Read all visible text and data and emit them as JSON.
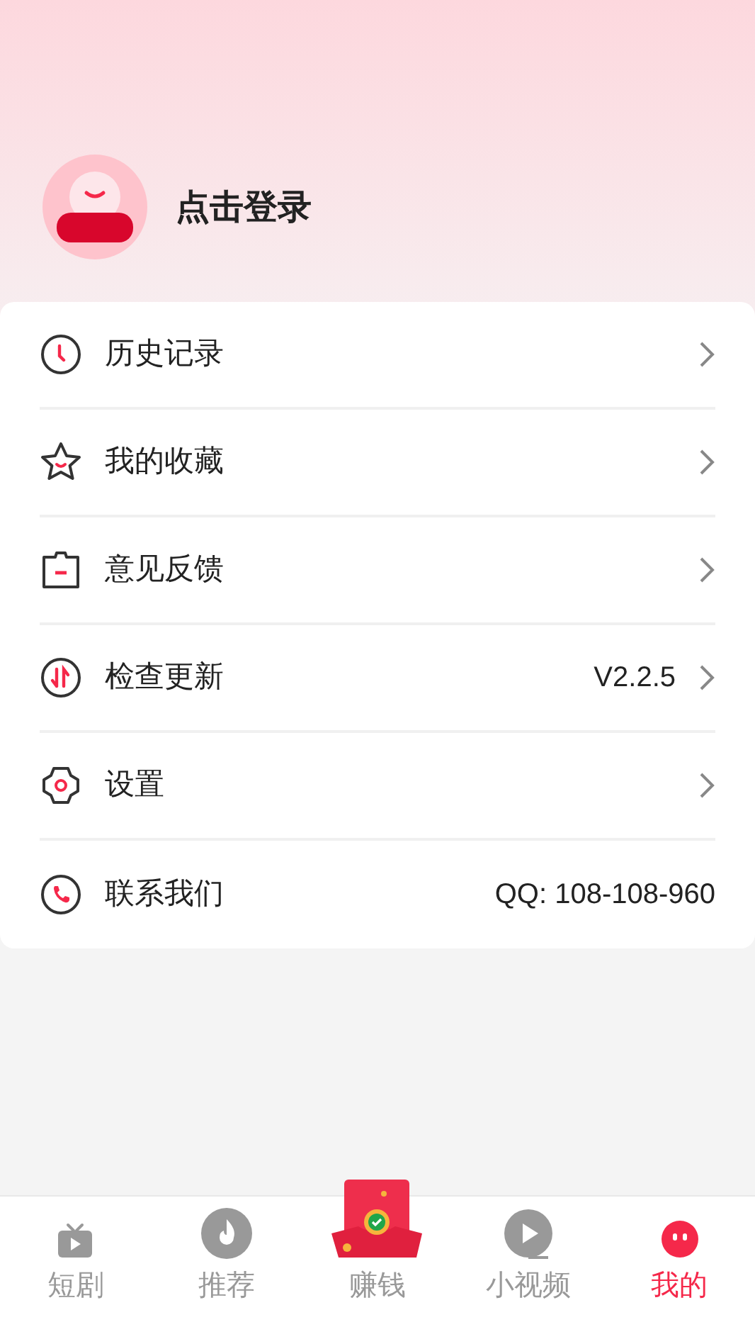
{
  "profile": {
    "login_label": "点击登录"
  },
  "menu": [
    {
      "label": "历史记录",
      "kind": "link"
    },
    {
      "label": "我的收藏",
      "kind": "link"
    },
    {
      "label": "意见反馈",
      "kind": "link"
    },
    {
      "label": "检查更新",
      "kind": "link",
      "value": "V2.2.5"
    },
    {
      "label": "设置",
      "kind": "link"
    },
    {
      "label": "联系我们",
      "kind": "info",
      "value": "QQ: 108-108-960"
    }
  ],
  "tab_bar": [
    {
      "label": "短剧",
      "selected": false
    },
    {
      "label": "推荐",
      "selected": false
    },
    {
      "label": "赚钱",
      "selected": false
    },
    {
      "label": "小视频",
      "selected": false
    },
    {
      "label": "我的",
      "selected": true
    }
  ]
}
